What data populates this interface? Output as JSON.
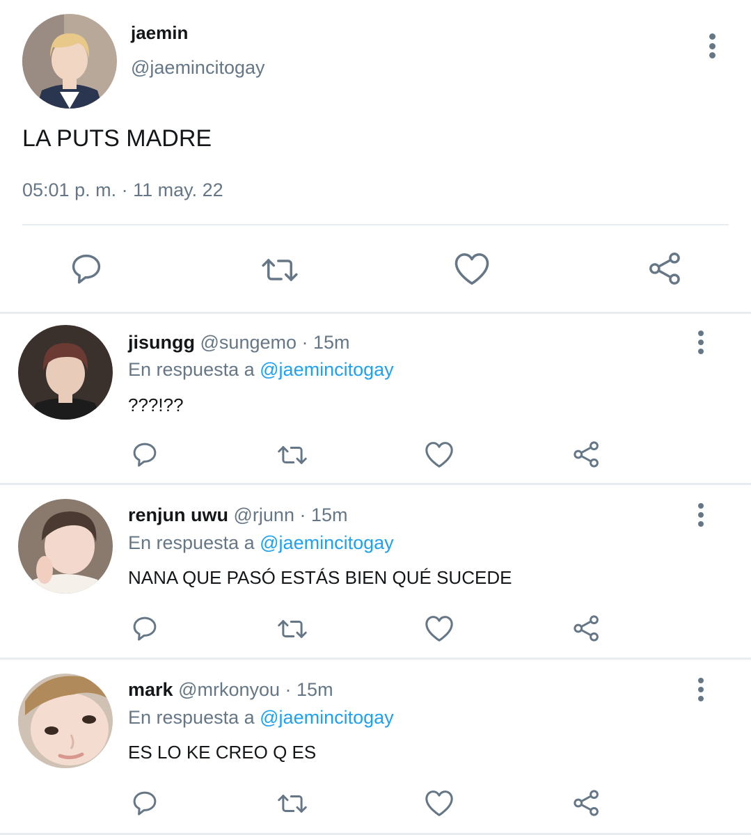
{
  "main_tweet": {
    "name": "jaemin",
    "handle": "@jaemincitogay",
    "text": "LA PUTS MADRE",
    "timestamp": "05:01 p. m. · 11 may. 22",
    "avatar_colors": {
      "bg": "#b8a89a",
      "hair": "#e8c98a",
      "skin": "#f2d6c4",
      "cloth": "#2a3550"
    }
  },
  "replies": [
    {
      "name": "jisungg",
      "handle": "@sungemo",
      "time": "15m",
      "reply_prefix": "En respuesta a",
      "mention": "@jaemincitogay",
      "text": "???!??",
      "avatar_colors": {
        "bg": "#3a302c",
        "hair": "#6b3a32",
        "skin": "#e8cbb8",
        "cloth": "#1c1c1c"
      }
    },
    {
      "name": "renjun uwu",
      "handle": "@rjunn",
      "time": "15m",
      "reply_prefix": "En respuesta a",
      "mention": "@jaemincitogay",
      "text": "NANA QUE PASÓ ESTÁS BIEN QUÉ SUCEDE",
      "avatar_colors": {
        "bg": "#8a7a6e",
        "hair": "#4a3a32",
        "skin": "#f3d9cd",
        "cloth": "#f5f0ea"
      }
    },
    {
      "name": "mark",
      "handle": "@mrkonyou",
      "time": "15m",
      "reply_prefix": "En respuesta a",
      "mention": "@jaemincitogay",
      "text": "ES LO KE CREO Q ES",
      "avatar_colors": {
        "bg": "#cfc2b4",
        "hair": "#b08a5a",
        "skin": "#f4ddd0",
        "cloth": "#e9dcd0"
      }
    }
  ],
  "icons": {
    "reply": "speech-bubble-icon",
    "retweet": "retweet-arrows-icon",
    "like": "heart-icon",
    "share": "share-nodes-icon",
    "more": "vertical-dots-icon"
  },
  "colors": {
    "text_primary": "#14171a",
    "text_secondary": "#657786",
    "accent": "#1da1f2",
    "divider": "#e6ecf0"
  }
}
